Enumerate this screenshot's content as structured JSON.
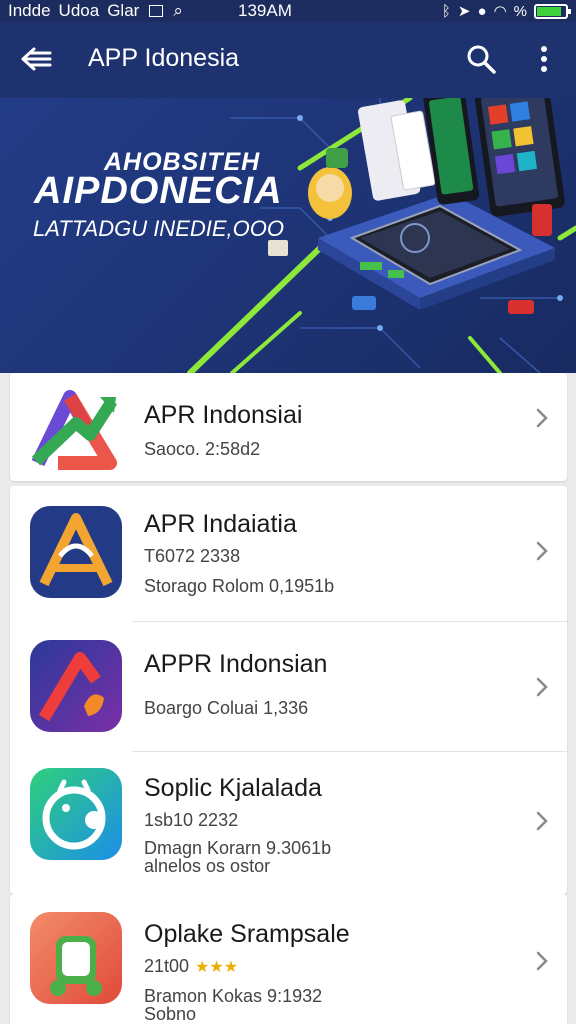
{
  "status_bar": {
    "left_text_1": "Indde",
    "left_text_2": "Udoa",
    "left_text_3": "Glar",
    "time": "139AM",
    "battery_text": "%"
  },
  "app_bar": {
    "title": "APP Idonesia"
  },
  "banner": {
    "line1": "AHOBSITEH",
    "line2": "AIPDONECIA",
    "line3": "LATTADGU INEDIE,OOO"
  },
  "apps": [
    {
      "name": "APR Indonsiai",
      "line1": "Saoco. 2:58d2",
      "line2": "",
      "line3": "",
      "stars": ""
    },
    {
      "name": "APR Indaiatia",
      "line1": "T6072 2338",
      "line2": "Storago Rolom 0,1951b",
      "line3": "",
      "stars": ""
    },
    {
      "name": "APPR Indonsian",
      "line1": "Boargo Coluai 1,336",
      "line2": "",
      "line3": "",
      "stars": ""
    },
    {
      "name": "Soplic Kjalalada",
      "line1": "1sb10 2232",
      "line2": "Dmagn Korarn 9.3061b",
      "line3": "alnelos os ostor",
      "stars": ""
    },
    {
      "name": "Oplake Srampsale",
      "line1": "21t00",
      "line2": "Bramon Kokas 9:1932",
      "line3": "Sobno",
      "stars": "★★★"
    }
  ]
}
